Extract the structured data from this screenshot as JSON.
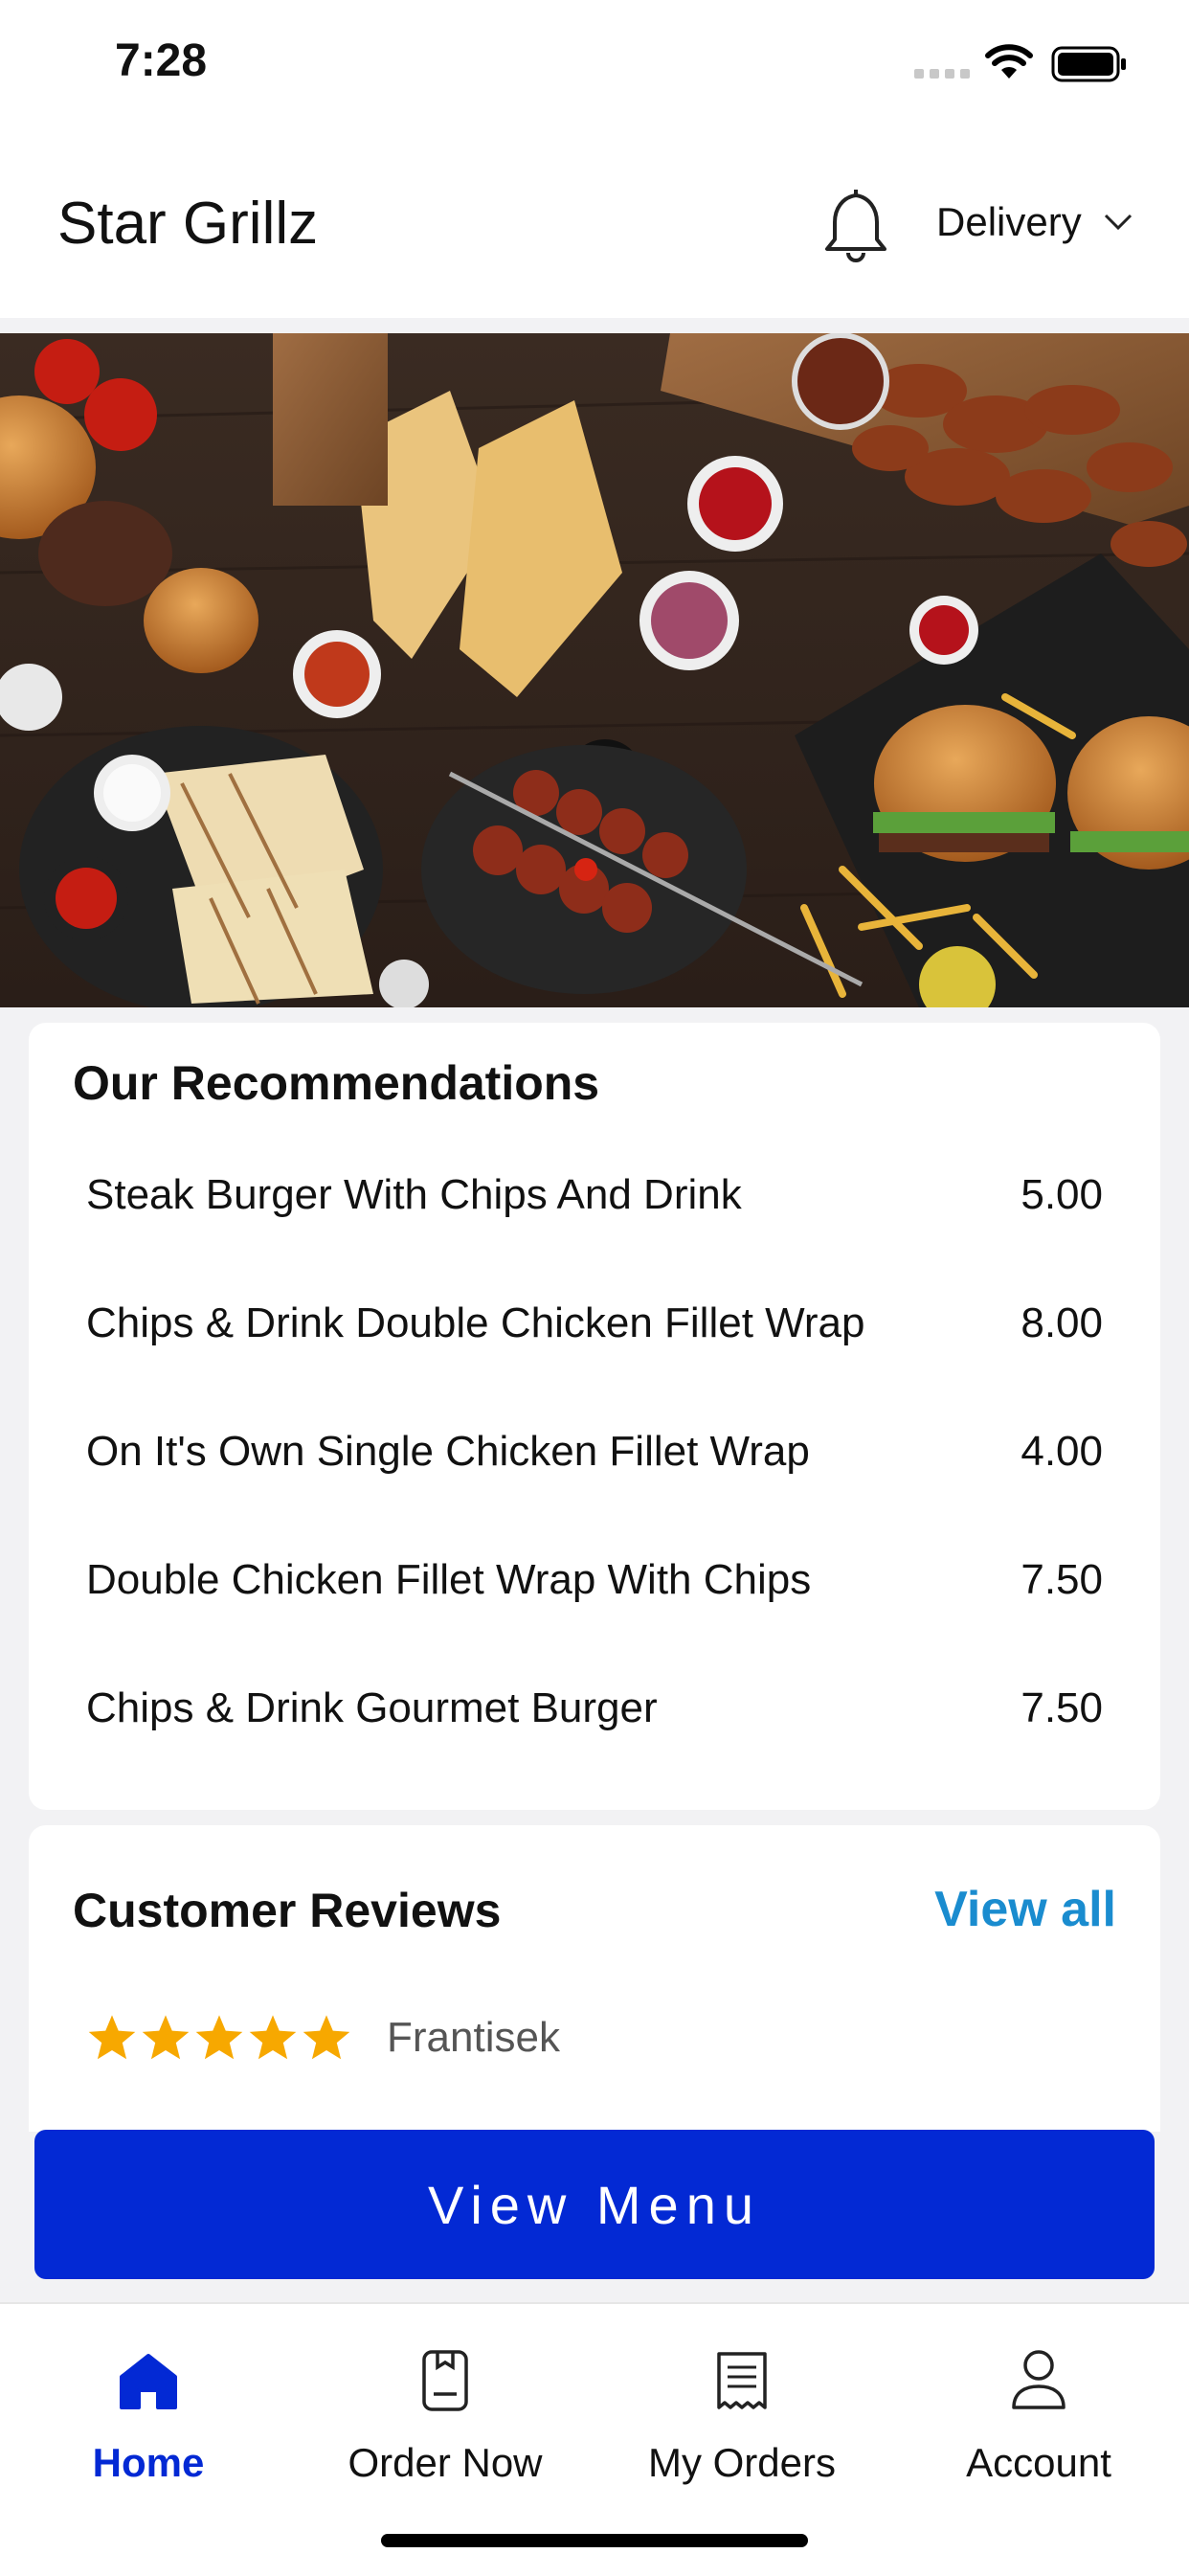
{
  "status_bar": {
    "time": "7:28"
  },
  "header": {
    "title": "Star Grillz",
    "delivery_label": "Delivery"
  },
  "recommendations": {
    "title": "Our Recommendations",
    "items": [
      {
        "name": "Steak Burger With Chips And Drink",
        "price": "5.00"
      },
      {
        "name": "Chips & Drink Double Chicken Fillet Wrap",
        "price": "8.00"
      },
      {
        "name": "On It's Own Single Chicken Fillet Wrap",
        "price": "4.00"
      },
      {
        "name": "Double Chicken Fillet Wrap With Chips",
        "price": "7.50"
      },
      {
        "name": "Chips & Drink Gourmet Burger",
        "price": "7.50"
      }
    ]
  },
  "reviews": {
    "title": "Customer Reviews",
    "view_all": "View all",
    "items": [
      {
        "reviewer": "Frantisek",
        "rating": 5
      }
    ]
  },
  "cta": {
    "label": "View Menu"
  },
  "bottom_nav": {
    "items": [
      {
        "label": "Home",
        "icon": "home-icon",
        "active": true
      },
      {
        "label": "Order Now",
        "icon": "order-icon",
        "active": false
      },
      {
        "label": "My Orders",
        "icon": "receipt-icon",
        "active": false
      },
      {
        "label": "Account",
        "icon": "user-icon",
        "active": false
      }
    ]
  },
  "colors": {
    "primary": "#0329d4",
    "link": "#1a8ccf",
    "star": "#f7a800"
  }
}
